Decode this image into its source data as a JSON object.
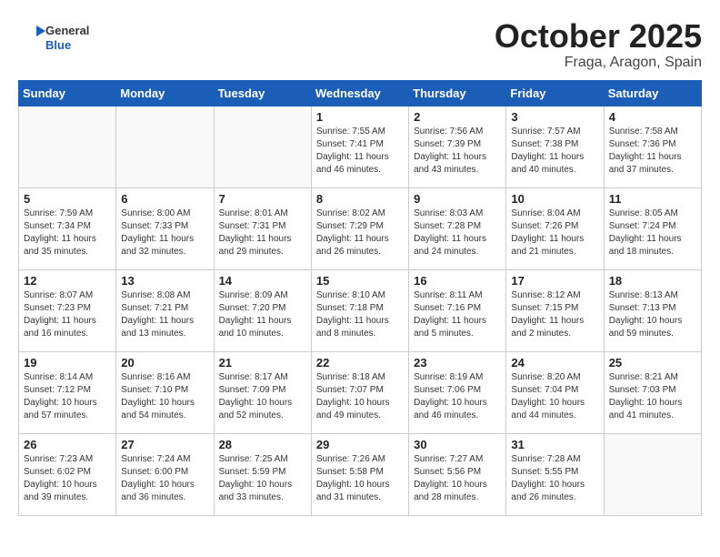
{
  "header": {
    "logo_general": "General",
    "logo_blue": "Blue",
    "month": "October 2025",
    "location": "Fraga, Aragon, Spain"
  },
  "weekdays": [
    "Sunday",
    "Monday",
    "Tuesday",
    "Wednesday",
    "Thursday",
    "Friday",
    "Saturday"
  ],
  "weeks": [
    [
      {
        "day": "",
        "info": ""
      },
      {
        "day": "",
        "info": ""
      },
      {
        "day": "",
        "info": ""
      },
      {
        "day": "1",
        "info": "Sunrise: 7:55 AM\nSunset: 7:41 PM\nDaylight: 11 hours\nand 46 minutes."
      },
      {
        "day": "2",
        "info": "Sunrise: 7:56 AM\nSunset: 7:39 PM\nDaylight: 11 hours\nand 43 minutes."
      },
      {
        "day": "3",
        "info": "Sunrise: 7:57 AM\nSunset: 7:38 PM\nDaylight: 11 hours\nand 40 minutes."
      },
      {
        "day": "4",
        "info": "Sunrise: 7:58 AM\nSunset: 7:36 PM\nDaylight: 11 hours\nand 37 minutes."
      }
    ],
    [
      {
        "day": "5",
        "info": "Sunrise: 7:59 AM\nSunset: 7:34 PM\nDaylight: 11 hours\nand 35 minutes."
      },
      {
        "day": "6",
        "info": "Sunrise: 8:00 AM\nSunset: 7:33 PM\nDaylight: 11 hours\nand 32 minutes."
      },
      {
        "day": "7",
        "info": "Sunrise: 8:01 AM\nSunset: 7:31 PM\nDaylight: 11 hours\nand 29 minutes."
      },
      {
        "day": "8",
        "info": "Sunrise: 8:02 AM\nSunset: 7:29 PM\nDaylight: 11 hours\nand 26 minutes."
      },
      {
        "day": "9",
        "info": "Sunrise: 8:03 AM\nSunset: 7:28 PM\nDaylight: 11 hours\nand 24 minutes."
      },
      {
        "day": "10",
        "info": "Sunrise: 8:04 AM\nSunset: 7:26 PM\nDaylight: 11 hours\nand 21 minutes."
      },
      {
        "day": "11",
        "info": "Sunrise: 8:05 AM\nSunset: 7:24 PM\nDaylight: 11 hours\nand 18 minutes."
      }
    ],
    [
      {
        "day": "12",
        "info": "Sunrise: 8:07 AM\nSunset: 7:23 PM\nDaylight: 11 hours\nand 16 minutes."
      },
      {
        "day": "13",
        "info": "Sunrise: 8:08 AM\nSunset: 7:21 PM\nDaylight: 11 hours\nand 13 minutes."
      },
      {
        "day": "14",
        "info": "Sunrise: 8:09 AM\nSunset: 7:20 PM\nDaylight: 11 hours\nand 10 minutes."
      },
      {
        "day": "15",
        "info": "Sunrise: 8:10 AM\nSunset: 7:18 PM\nDaylight: 11 hours\nand 8 minutes."
      },
      {
        "day": "16",
        "info": "Sunrise: 8:11 AM\nSunset: 7:16 PM\nDaylight: 11 hours\nand 5 minutes."
      },
      {
        "day": "17",
        "info": "Sunrise: 8:12 AM\nSunset: 7:15 PM\nDaylight: 11 hours\nand 2 minutes."
      },
      {
        "day": "18",
        "info": "Sunrise: 8:13 AM\nSunset: 7:13 PM\nDaylight: 10 hours\nand 59 minutes."
      }
    ],
    [
      {
        "day": "19",
        "info": "Sunrise: 8:14 AM\nSunset: 7:12 PM\nDaylight: 10 hours\nand 57 minutes."
      },
      {
        "day": "20",
        "info": "Sunrise: 8:16 AM\nSunset: 7:10 PM\nDaylight: 10 hours\nand 54 minutes."
      },
      {
        "day": "21",
        "info": "Sunrise: 8:17 AM\nSunset: 7:09 PM\nDaylight: 10 hours\nand 52 minutes."
      },
      {
        "day": "22",
        "info": "Sunrise: 8:18 AM\nSunset: 7:07 PM\nDaylight: 10 hours\nand 49 minutes."
      },
      {
        "day": "23",
        "info": "Sunrise: 8:19 AM\nSunset: 7:06 PM\nDaylight: 10 hours\nand 46 minutes."
      },
      {
        "day": "24",
        "info": "Sunrise: 8:20 AM\nSunset: 7:04 PM\nDaylight: 10 hours\nand 44 minutes."
      },
      {
        "day": "25",
        "info": "Sunrise: 8:21 AM\nSunset: 7:03 PM\nDaylight: 10 hours\nand 41 minutes."
      }
    ],
    [
      {
        "day": "26",
        "info": "Sunrise: 7:23 AM\nSunset: 6:02 PM\nDaylight: 10 hours\nand 39 minutes."
      },
      {
        "day": "27",
        "info": "Sunrise: 7:24 AM\nSunset: 6:00 PM\nDaylight: 10 hours\nand 36 minutes."
      },
      {
        "day": "28",
        "info": "Sunrise: 7:25 AM\nSunset: 5:59 PM\nDaylight: 10 hours\nand 33 minutes."
      },
      {
        "day": "29",
        "info": "Sunrise: 7:26 AM\nSunset: 5:58 PM\nDaylight: 10 hours\nand 31 minutes."
      },
      {
        "day": "30",
        "info": "Sunrise: 7:27 AM\nSunset: 5:56 PM\nDaylight: 10 hours\nand 28 minutes."
      },
      {
        "day": "31",
        "info": "Sunrise: 7:28 AM\nSunset: 5:55 PM\nDaylight: 10 hours\nand 26 minutes."
      },
      {
        "day": "",
        "info": ""
      }
    ]
  ]
}
